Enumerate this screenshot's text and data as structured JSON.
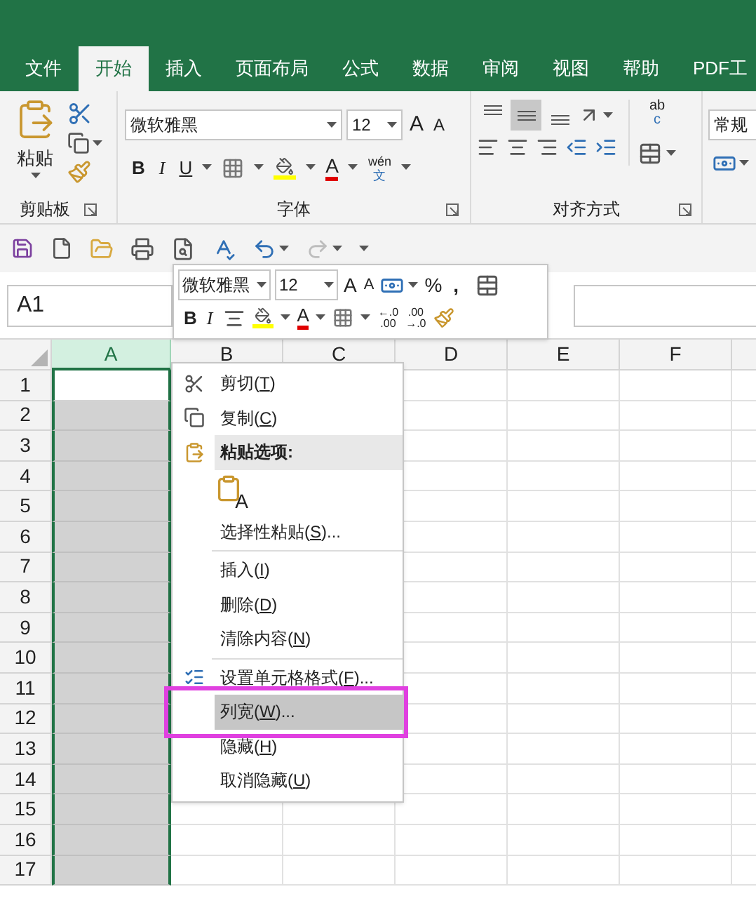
{
  "ribbon_tabs": [
    {
      "label": "文件",
      "selected": false
    },
    {
      "label": "开始",
      "selected": true
    },
    {
      "label": "插入",
      "selected": false
    },
    {
      "label": "页面布局",
      "selected": false
    },
    {
      "label": "公式",
      "selected": false
    },
    {
      "label": "数据",
      "selected": false
    },
    {
      "label": "审阅",
      "selected": false
    },
    {
      "label": "视图",
      "selected": false
    },
    {
      "label": "帮助",
      "selected": false
    },
    {
      "label": "PDF工",
      "selected": false
    }
  ],
  "ribbon": {
    "clipboard": {
      "paste_label": "粘贴",
      "group_label": "剪贴板"
    },
    "font": {
      "font_name": "微软雅黑",
      "font_size": "12",
      "grow_glyph": "A",
      "shrink_glyph": "A",
      "bold": "B",
      "italic": "I",
      "underline": "U",
      "font_color": "A",
      "phonetic_top": "wén",
      "phonetic_bottom": "文",
      "group_label": "字体"
    },
    "alignment": {
      "vertical_align": [
        {
          "kind": "top",
          "selected": false
        },
        {
          "kind": "middle",
          "selected": true
        },
        {
          "kind": "bottom",
          "selected": false
        }
      ],
      "wrap_top": "ab",
      "wrap_bottom": "c",
      "group_label": "对齐方式"
    },
    "number": {
      "format": "常规"
    }
  },
  "quick_access": {
    "redo": {
      "disabled": true
    }
  },
  "name_box": "A1",
  "mini_toolbar": {
    "font_name": "微软雅黑",
    "font_size": "12",
    "grow_glyph": "A",
    "shrink_glyph": "A",
    "percent": "%",
    "comma": ",",
    "bold": "B",
    "italic": "I",
    "font_color": "A",
    "decimals": [
      {
        "top": "←.0",
        "bottom": ".00"
      },
      {
        "top": ".00",
        "bottom": "→.0"
      }
    ]
  },
  "sheet": {
    "columns": [
      {
        "label": "A",
        "selected": true
      },
      {
        "label": "B",
        "selected": false
      },
      {
        "label": "C",
        "selected": false
      },
      {
        "label": "D",
        "selected": false
      },
      {
        "label": "E",
        "selected": false
      },
      {
        "label": "F",
        "selected": false
      }
    ],
    "rows": [
      "1",
      "2",
      "3",
      "4",
      "5",
      "6",
      "7",
      "8",
      "9",
      "10",
      "11",
      "12",
      "13",
      "14",
      "15",
      "16",
      "17"
    ]
  },
  "context_menu": [
    {
      "kind": "cut",
      "before": "剪切(",
      "accel": "T",
      "after": ")",
      "selected": false
    },
    {
      "kind": "copy",
      "before": "复制(",
      "accel": "C",
      "after": ")",
      "selected": false
    },
    {
      "kind": "header",
      "before": "粘贴选项:"
    },
    {
      "kind": "paste_option",
      "glyph": "A"
    },
    {
      "kind": "item",
      "before": "选择性粘贴(",
      "accel": "S",
      "after": ")...",
      "selected": false
    },
    {
      "kind": "separator"
    },
    {
      "kind": "item",
      "before": "插入(",
      "accel": "I",
      "after": ")",
      "selected": false
    },
    {
      "kind": "item",
      "before": "删除(",
      "accel": "D",
      "after": ")",
      "selected": false
    },
    {
      "kind": "item",
      "before": "清除内容(",
      "accel": "N",
      "after": ")",
      "selected": false
    },
    {
      "kind": "separator"
    },
    {
      "kind": "format",
      "before": "设置单元格格式(",
      "accel": "F",
      "after": ")...",
      "selected": false
    },
    {
      "kind": "item",
      "before": "列宽(",
      "accel": "W",
      "after": ")...",
      "selected": true
    },
    {
      "kind": "item",
      "before": "隐藏(",
      "accel": "H",
      "after": ")",
      "selected": false
    },
    {
      "kind": "item",
      "before": "取消隐藏(",
      "accel": "U",
      "after": ")",
      "selected": false
    }
  ]
}
